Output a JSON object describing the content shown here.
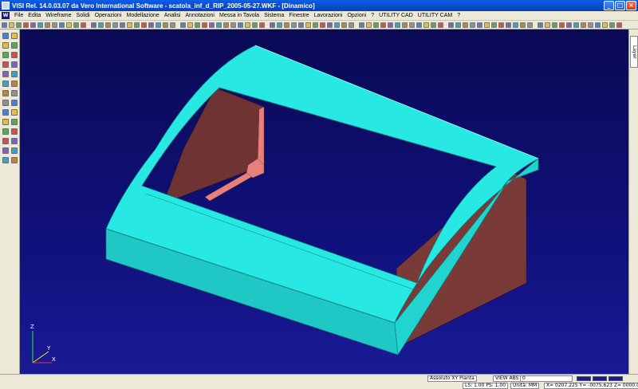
{
  "window": {
    "title": "VISI Rel. 14.0.03.07 da Vero International Software - scatola_inf_d_RIP_2005-05-27.WKF - [Dinamico]"
  },
  "menu": {
    "items": [
      "File",
      "Edita",
      "Wireframe",
      "Solidi",
      "Operazioni",
      "Modellazione",
      "Analisi",
      "Annotazioni",
      "Messa in Tavola",
      "Sistema",
      "Finestre",
      "Lavorazioni",
      "Opzioni",
      "?",
      "UTILITY CAD",
      "UTILITY CAM",
      "?"
    ]
  },
  "right_panel": {
    "tab_label": "Layer"
  },
  "axes": {
    "z": "Z",
    "y": "Y",
    "x": "X"
  },
  "status": {
    "mode": "Assoluto XY Pianta",
    "view": "VIEW ABS",
    "layer_value": "0",
    "ls_ps": "LS: 1.00 PS: 1.00",
    "units": "Unità: MM",
    "coords": "X= 0207.225 Y= -0075.623 Z= 0000.000"
  },
  "colors": {
    "part_top": "#27e8e2",
    "part_side": "#1fc8c4",
    "part_interior": "#7a3a38",
    "part_highlight": "#e8807a",
    "background": "#10107a"
  }
}
